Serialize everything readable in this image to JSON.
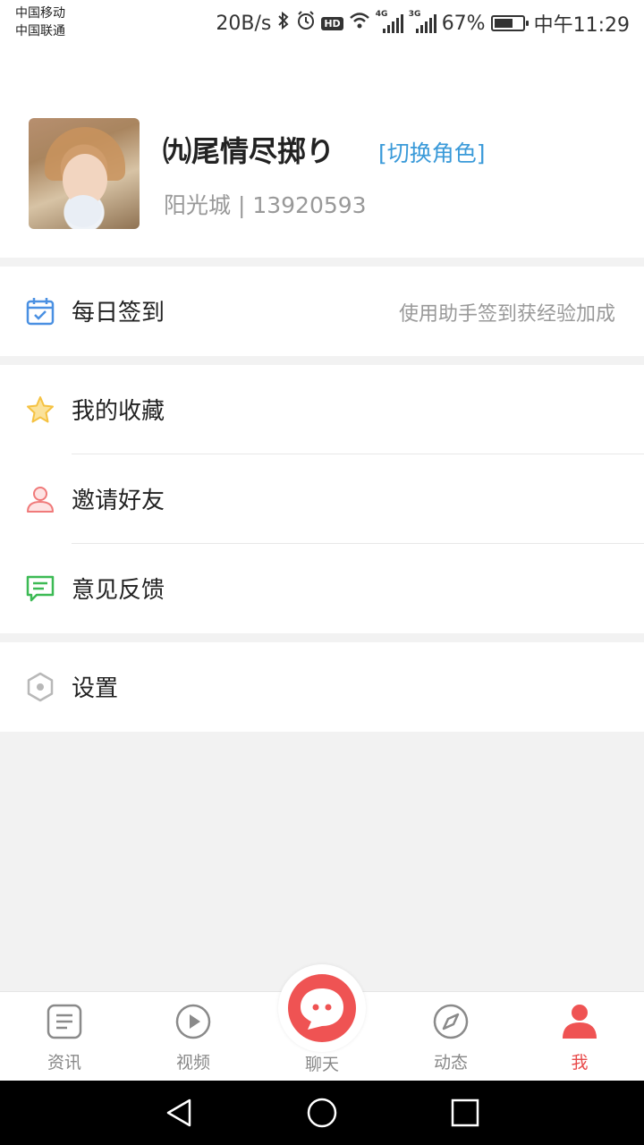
{
  "status_bar": {
    "carrier_1": "中国移动",
    "carrier_2": "中国联通",
    "net_speed": "20B/s",
    "signal_1_type": "4G",
    "signal_2_type": "3G",
    "battery": "67%",
    "battery_level": 0.67,
    "time": "中午11:29",
    "icons": [
      "bluetooth-icon",
      "alarm-icon",
      "hd-icon",
      "wifi-icon",
      "signal-icon",
      "battery-icon"
    ]
  },
  "profile": {
    "username": "㈨尾情尽掷り",
    "switch_role": "[切换角色]",
    "sub_info": "阳光城 | 13920593"
  },
  "menu": {
    "checkin": {
      "label": "每日签到",
      "hint": "使用助手签到获经验加成",
      "icon": "calendar-check-icon",
      "color": "#4a90e2"
    },
    "favorites": {
      "label": "我的收藏",
      "icon": "star-icon",
      "color": "#f5c242"
    },
    "invite": {
      "label": "邀请好友",
      "icon": "person-icon",
      "color": "#f07a7a"
    },
    "feedback": {
      "label": "意见反馈",
      "icon": "message-icon",
      "color": "#3cba54"
    },
    "settings": {
      "label": "设置",
      "icon": "hexagon-settings-icon",
      "color": "#b0b0b0"
    }
  },
  "tabbar": {
    "items": [
      {
        "label": "资讯",
        "icon": "news-icon",
        "active": false
      },
      {
        "label": "视频",
        "icon": "play-icon",
        "active": false
      },
      {
        "label": "聊天",
        "icon": "chat-icon",
        "active": false
      },
      {
        "label": "动态",
        "icon": "compass-icon",
        "active": false
      },
      {
        "label": "我",
        "icon": "user-icon",
        "active": true
      }
    ],
    "accent": "#e84a4a"
  },
  "navbar": {
    "icons": [
      "back-triangle-icon",
      "home-circle-icon",
      "recents-square-icon"
    ]
  }
}
